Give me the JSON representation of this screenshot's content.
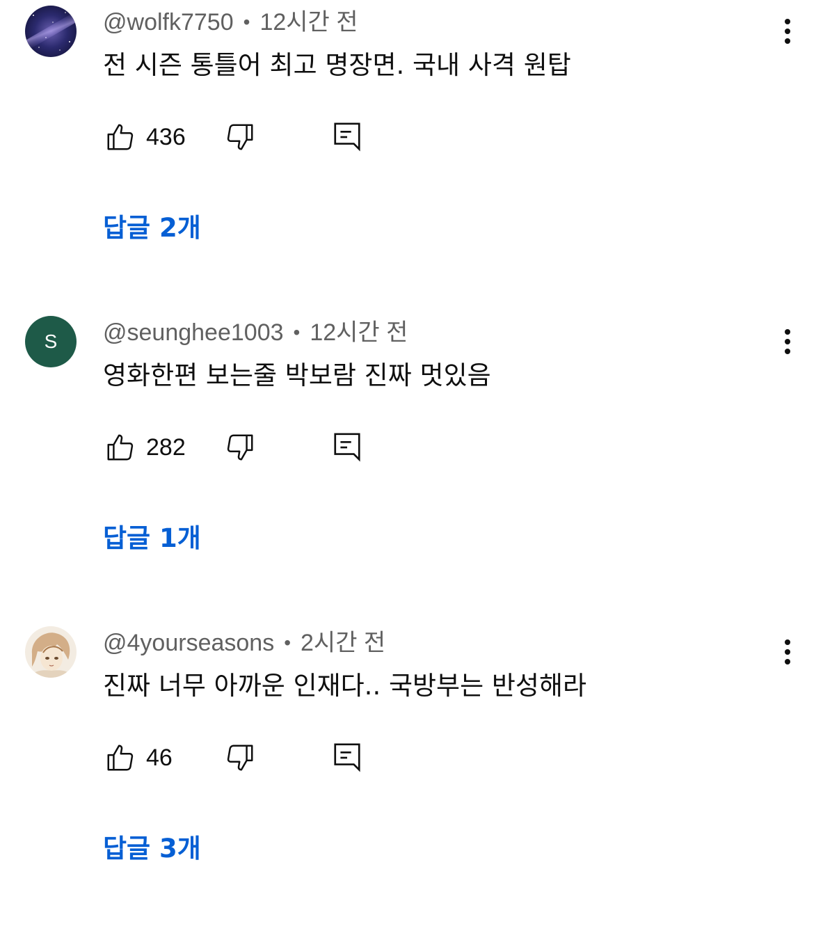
{
  "comments": [
    {
      "handle": "@wolfk7750",
      "time": "12시간 전",
      "text": "전 시즌 통틀어 최고 명장면. 국내 사격 원탑",
      "likes": "436",
      "replies": "답글 2개",
      "avatar": {
        "type": "image",
        "icon": "galaxy-avatar"
      }
    },
    {
      "handle": "@seunghee1003",
      "time": "12시간 전",
      "text": "영화한편 보는줄 박보람 진짜 멋있음",
      "likes": "282",
      "replies": "답글 1개",
      "avatar": {
        "type": "letter",
        "letter": "S",
        "color": "#1e5a48"
      }
    },
    {
      "handle": "@4yourseasons",
      "time": "2시간 전",
      "text": "진짜 너무 아까운 인재다.. 국방부는 반성해라",
      "likes": "46",
      "replies": "답글 3개",
      "avatar": {
        "type": "image",
        "icon": "anime-sketch-avatar"
      }
    }
  ],
  "separator": "•",
  "colors": {
    "link": "#065fd4",
    "meta": "#606060",
    "text": "#0f0f0f"
  }
}
